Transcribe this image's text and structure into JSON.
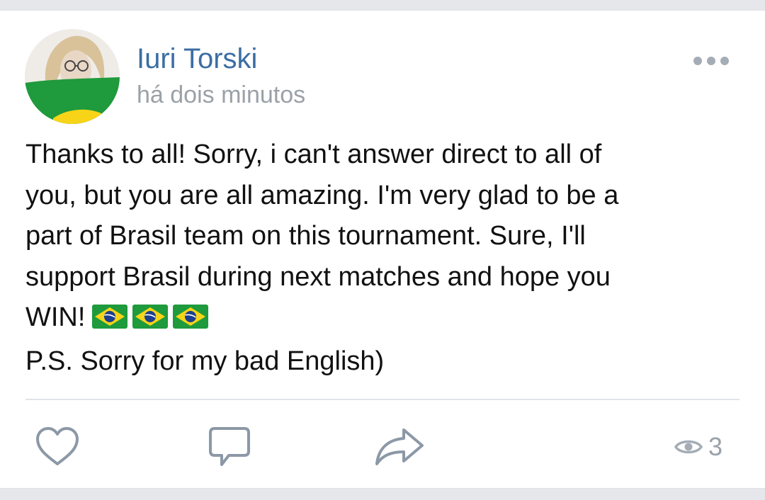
{
  "post": {
    "author": "Iuri Torski",
    "time": "há dois minutos",
    "lines": [
      "Thanks to all! Sorry, i can't answer direct to all of",
      "you, but you are all amazing. I'm very glad to be a",
      "part of Brasil team on this tournament. Sure, I'll",
      "support Brasil during next matches and hope you",
      "WIN!",
      "P.S. Sorry for my bad English)"
    ]
  },
  "actions": {
    "like_icon": "heart-icon",
    "comment_icon": "comment-icon",
    "share_icon": "share-arrow-icon",
    "views_icon": "eye-icon",
    "views_count": "3"
  },
  "colors": {
    "author": "#3b6ea3",
    "muted": "#9aa1a8",
    "icon": "#8c98a6",
    "flag_green": "#1f9a3c",
    "flag_yellow": "#f7d417",
    "flag_blue": "#1d3f8f"
  }
}
